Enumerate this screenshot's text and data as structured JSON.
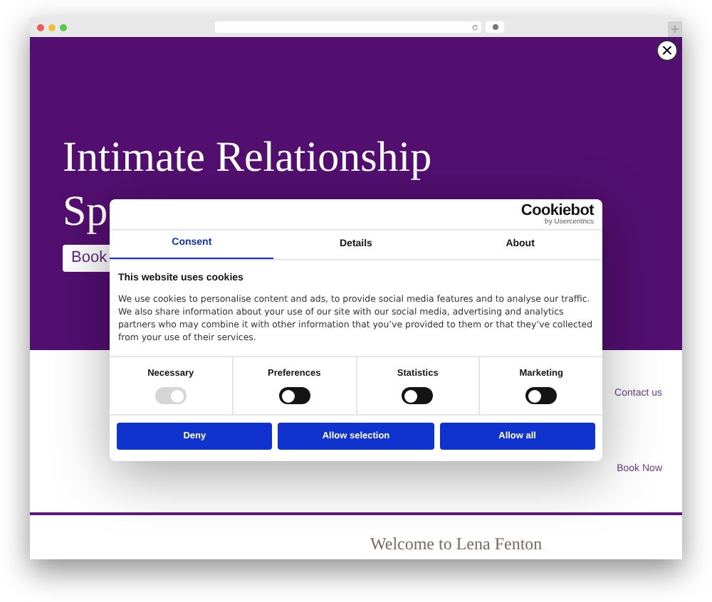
{
  "browser": {
    "close_symbol": "×"
  },
  "hero": {
    "title_line1": "Intimate Relationship",
    "title_line2": "Sp",
    "button": "Book"
  },
  "side_links": [
    "Contact us",
    "Book Now"
  ],
  "welcome": "Welcome to Lena Fenton",
  "cookie_dialog": {
    "logo": "Cookiebot",
    "logo_sub": "by Usercentrics",
    "tabs": [
      {
        "label": "Consent",
        "selected": true
      },
      {
        "label": "Details",
        "selected": false
      },
      {
        "label": "About",
        "selected": false
      }
    ],
    "heading": "This website uses cookies",
    "body": "We use cookies to personalise content and ads, to provide social media features and to analyse our traffic. We also share information about your use of our site with our social media, advertising and analytics partners who may combine it with other information that you’ve provided to them or that they’ve collected from your use of their services.",
    "toggles": [
      {
        "label": "Necessary",
        "on": true,
        "disabled": true
      },
      {
        "label": "Preferences",
        "on": false,
        "disabled": false
      },
      {
        "label": "Statistics",
        "on": false,
        "disabled": false
      },
      {
        "label": "Marketing",
        "on": false,
        "disabled": false
      }
    ],
    "buttons": [
      "Deny",
      "Allow selection",
      "Allow all"
    ]
  }
}
